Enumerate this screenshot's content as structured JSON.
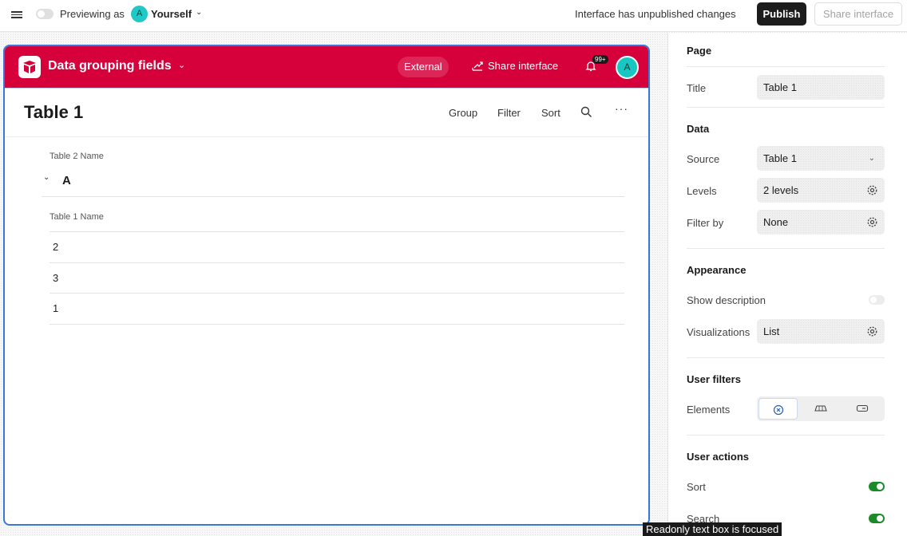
{
  "topbar": {
    "previewing_label": "Previewing as",
    "user_avatar": "A",
    "user_name": "Yourself",
    "status": "Interface has unpublished changes",
    "publish_label": "Publish",
    "share_label": "Share interface"
  },
  "brand": {
    "base_name": "Data grouping fields",
    "external_label": "External",
    "share_label": "Share interface",
    "notification_count": "99+",
    "avatar": "A",
    "color": "#d6003b"
  },
  "page": {
    "title": "Table 1",
    "toolbar": {
      "group": "Group",
      "filter": "Filter",
      "sort": "Sort"
    },
    "group_field_label": "Table 2 Name",
    "group_value": "A",
    "column_label": "Table 1 Name",
    "rows": [
      "2",
      "3",
      "1"
    ]
  },
  "sidebar": {
    "page_section": "Page",
    "title_label": "Title",
    "title_value": "Table 1",
    "data_section": "Data",
    "source_label": "Source",
    "source_value": "Table 1",
    "levels_label": "Levels",
    "levels_value": "2 levels",
    "filter_label": "Filter by",
    "filter_value": "None",
    "appearance_section": "Appearance",
    "show_description_label": "Show description",
    "visualizations_label": "Visualizations",
    "visualizations_value": "List",
    "user_filters_section": "User filters",
    "elements_label": "Elements",
    "user_actions_section": "User actions",
    "sort_label": "Sort",
    "search_label": "Search"
  },
  "tooltip": "Readonly text box is focused"
}
